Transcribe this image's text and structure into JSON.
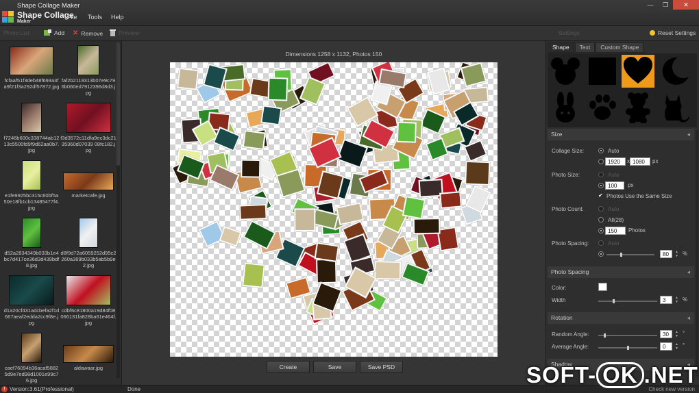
{
  "window": {
    "title": "Shape Collage Maker",
    "app_name_big": "Shape Collage",
    "app_name_sub": "Maker",
    "controls": {
      "minimize": "—",
      "restore": "❐",
      "close": "✕"
    }
  },
  "menu": {
    "items": [
      "File",
      "Tools",
      "Help"
    ]
  },
  "toolbar": {
    "left_header": "Photo List",
    "add": "Add",
    "remove": "Remove",
    "preview": "Preview",
    "settings": "Settings",
    "reset": "Reset Settings"
  },
  "photos": [
    {
      "name": "fcfaaf51f3deb48f693a3fa9f21f3a292df57872.jpg",
      "colors": [
        "#8a2a1a",
        "#d9a67a",
        "#6a7a4a"
      ]
    },
    {
      "name": "faf2b2119313b07e9c796b060ed7912396d8d3.jpg",
      "colors": [
        "#4a6a2a",
        "#c8b89a",
        "#8a9a5a"
      ]
    },
    {
      "name": "f7246b600c338744ab1213c5500fd9f9d62aa0b7.jpg",
      "colors": [
        "#3a2a2a",
        "#9a7a6a",
        "#d8c8a8"
      ]
    },
    {
      "name": "f3d3572c11dfa9ec3dc2135360d07039 08fc182.jpg",
      "colors": [
        "#b01a2a",
        "#701020",
        "#d03040"
      ]
    },
    {
      "name": "e1fe9925bc315c60bf5a50e18fb1cb13485477f4.jpg",
      "colors": [
        "#c8e080",
        "#e8f0a0",
        "#a8c050"
      ]
    },
    {
      "name": "marketcafe.jpg",
      "colors": [
        "#c86a2a",
        "#7a3a1a",
        "#e8a85a"
      ]
    },
    {
      "name": "d52a2834349b033b1e4bc7d417ce36d3d439bdf8.jpg",
      "colors": [
        "#2a8a2a",
        "#60c040",
        "#1a5a1a"
      ]
    },
    {
      "name": "d8f9d72a6059252d95c2260a369b033b5ab5b9e2.jpg",
      "colors": [
        "#a0c8e8",
        "#f0f0f0",
        "#d0d8e0"
      ]
    },
    {
      "name": "d1a20cf431adcbefa2f1d667aeaf2edda2cc9f8e.jpg",
      "colors": [
        "#0a2a2a",
        "#1a4a4a",
        "#0a1a1a"
      ]
    },
    {
      "name": "cdbf6c81800a19d84f08066131fa828ba61e464f.jpg",
      "colors": [
        "#e8e8e8",
        "#c01020",
        "#a0c060"
      ]
    },
    {
      "name": "caef76094b36acaf58825d9e7ed98d1001e99c76.jpg",
      "colors": [
        "#5a3a1a",
        "#c8a070",
        "#2a1a0a"
      ]
    },
    {
      "name": "aldawaar.jpg",
      "colors": [
        "#6a3a1a",
        "#c88a4a",
        "#2a1a0a"
      ]
    }
  ],
  "center": {
    "dimensions": "Dimensions 1258 x 1132, Photos 150",
    "buttons": [
      "Create",
      "Save",
      "Save PSD"
    ]
  },
  "right": {
    "tabs": [
      "Shape",
      "Text",
      "Custom Shape"
    ],
    "shapes": [
      "mickey-icon",
      "square-icon",
      "heart-icon",
      "crescent-moon-icon",
      "rabbit-icon",
      "paw-icon",
      "bear-icon",
      "cat-icon"
    ],
    "selected_shape": "heart-icon",
    "accent": "#f09a1c",
    "size": {
      "section": "Size",
      "collage_size_label": "Collage Size:",
      "auto": "Auto",
      "width": "1920",
      "x": "x",
      "height": "1080",
      "unit_px": "px",
      "photo_size_label": "Photo Size:",
      "photo_auto": "Auto",
      "photo_size": "100",
      "same_size": "Photos Use the Same Size",
      "photo_count_label": "Photo Count:",
      "count_auto": "Auto",
      "count_all": "All(28)",
      "count": "150",
      "count_unit": "Photos",
      "spacing_label": "Photo Spacing:",
      "spacing_auto": "Auto",
      "spacing": "80",
      "spacing_unit": "%",
      "spacing_level": 0.3
    },
    "border": {
      "section": "Photo Spacing",
      "color_label": "Color:",
      "width_label": "Width",
      "width": "3",
      "width_unit": "%",
      "width_level": 0.25
    },
    "rotation": {
      "section": "Rotation",
      "random_label": "Random Angle:",
      "random": "30",
      "average_label": "Average Angle:",
      "average": "0",
      "deg": "°",
      "random_level": 0.1,
      "average_level": 0.5
    },
    "next_section": "Shadow"
  },
  "status": {
    "version": "Version:3.61(Professional)",
    "state": "Done",
    "check": "Check new version"
  },
  "watermark": {
    "left": "SOFT-",
    "mid": "OK",
    ".right": ".NET",
    "right": ".NET"
  }
}
